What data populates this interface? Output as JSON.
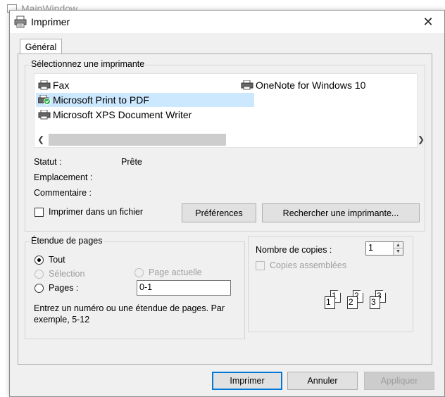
{
  "background_window": {
    "title": "MainWindow"
  },
  "dialog": {
    "title": "Imprimer",
    "tabs": [
      {
        "label": "Général",
        "active": true
      }
    ],
    "select_printer": {
      "group_label": "Sélectionnez une imprimante",
      "printers": [
        {
          "name": "Fax",
          "selected": false,
          "icon": "printer-icon"
        },
        {
          "name": "Microsoft Print to PDF",
          "selected": true,
          "icon": "default-printer-icon"
        },
        {
          "name": "Microsoft XPS Document Writer",
          "selected": false,
          "icon": "printer-icon"
        },
        {
          "name": "OneNote for Windows 10",
          "selected": false,
          "icon": "printer-icon"
        }
      ],
      "status_label": "Statut :",
      "status_value": "Prête",
      "location_label": "Emplacement :",
      "location_value": "",
      "comment_label": "Commentaire :",
      "comment_value": "",
      "print_to_file_label": "Imprimer dans un fichier",
      "print_to_file_checked": false,
      "preferences_button": "Préférences",
      "find_printer_button": "Rechercher une imprimante..."
    },
    "page_range": {
      "group_label": "Étendue de pages",
      "all_label": "Tout",
      "selection_label": "Sélection",
      "current_page_label": "Page actuelle",
      "pages_label": "Pages :",
      "pages_value": "0-1",
      "selected_option": "all",
      "help_text": "Entrez un numéro ou une étendue de pages. Par exemple, 5-12"
    },
    "copies": {
      "number_label": "Nombre de copies :",
      "number_value": "1",
      "collate_label": "Copies assemblées",
      "collate_checked": false,
      "collate_pages": [
        "1",
        "1",
        "2",
        "2",
        "3",
        "3"
      ]
    },
    "buttons": {
      "print": "Imprimer",
      "cancel": "Annuler",
      "apply": "Appliquer"
    }
  },
  "colors": {
    "selection": "#cce8ff",
    "default_button_border": "#0078d7",
    "default_printer_badge": "#2bb24c"
  }
}
